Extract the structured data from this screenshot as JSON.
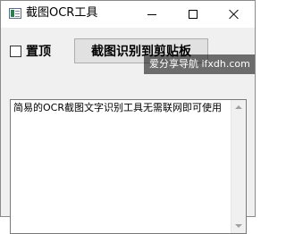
{
  "window": {
    "title": "截图OCR工具",
    "app_icon": "app-window-icon"
  },
  "controls": {
    "pin_label": "置顶",
    "pin_checked": false,
    "capture_button_label": "截图识别到剪贴板"
  },
  "watermark": {
    "text": "爱分享导航 ifxdh.com"
  },
  "output": {
    "text": "简易的OCR截图文字识别工具无需联网即可使用"
  },
  "colors": {
    "client_bg": "#f0f0f0",
    "button_bg": "#e1e1e1",
    "textarea_bg": "#ffffff"
  }
}
